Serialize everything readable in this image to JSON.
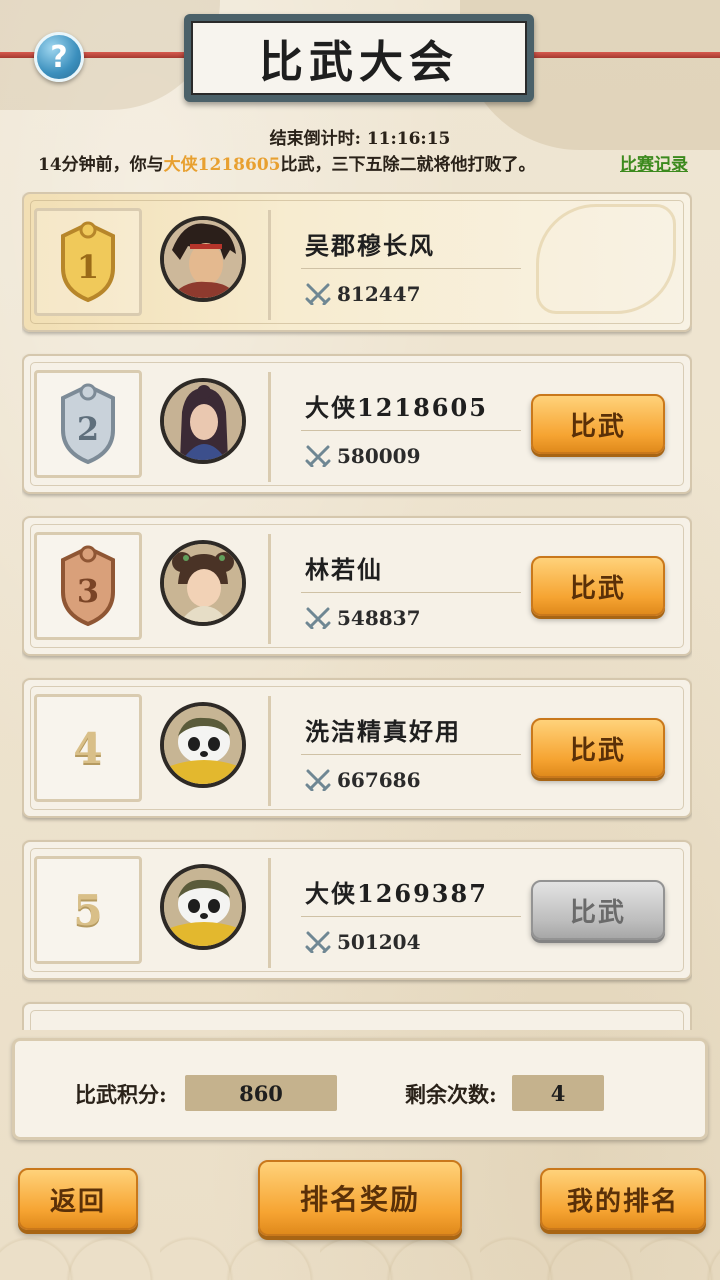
{
  "header": {
    "title": "比武大会",
    "help_icon": "question-mark-icon",
    "countdown": "结束倒计时: 11:16:15"
  },
  "news": {
    "prefix": "14分钟前，你与",
    "opponent": "大侠1218605",
    "suffix": "比武，三下五除二就将他打败了。",
    "record_link": "比赛记录"
  },
  "ranking": [
    {
      "rank": "1",
      "name": "吴郡穆长风",
      "power": "812447",
      "button": "",
      "button_state": "none",
      "avatar": "swordsman-avatar"
    },
    {
      "rank": "2",
      "name": "大侠1218605",
      "power": "580009",
      "button": "比武",
      "button_state": "active",
      "avatar": "female-warrior-avatar"
    },
    {
      "rank": "3",
      "name": "林若仙",
      "power": "548837",
      "button": "比武",
      "button_state": "active",
      "avatar": "girl-avatar"
    },
    {
      "rank": "4",
      "name": "洗洁精真好用",
      "power": "667686",
      "button": "比武",
      "button_state": "active",
      "avatar": "panda-avatar"
    },
    {
      "rank": "5",
      "name": "大侠1269387",
      "power": "501204",
      "button": "比武",
      "button_state": "disabled",
      "avatar": "panda-avatar"
    }
  ],
  "score": {
    "points_label": "比武积分:",
    "points_value": "860",
    "remaining_label": "剩余次数:",
    "remaining_value": "4"
  },
  "footer": {
    "back": "返回",
    "rank_reward": "排名奖励",
    "my_rank": "我的排名"
  },
  "colors": {
    "accent_orange": "#f6a432",
    "highlight_name": "#e8a030",
    "link_green": "#3c8a1e",
    "medal_gold": "#e2b03c",
    "medal_silver": "#b8c4cf",
    "medal_bronze": "#c98a5c"
  }
}
